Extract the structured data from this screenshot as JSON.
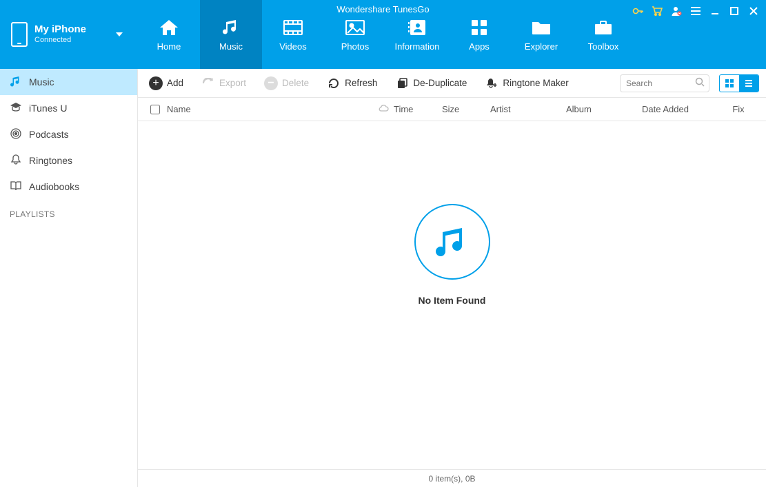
{
  "app": {
    "title": "Wondershare TunesGo"
  },
  "device": {
    "name": "My iPhone",
    "status": "Connected"
  },
  "nav": {
    "items": [
      {
        "id": "home",
        "label": "Home"
      },
      {
        "id": "music",
        "label": "Music",
        "active": true
      },
      {
        "id": "videos",
        "label": "Videos"
      },
      {
        "id": "photos",
        "label": "Photos"
      },
      {
        "id": "information",
        "label": "Information"
      },
      {
        "id": "apps",
        "label": "Apps"
      },
      {
        "id": "explorer",
        "label": "Explorer"
      },
      {
        "id": "toolbox",
        "label": "Toolbox"
      }
    ]
  },
  "sidebar": {
    "items": [
      {
        "id": "music",
        "label": "Music",
        "active": true
      },
      {
        "id": "itunesu",
        "label": "iTunes U"
      },
      {
        "id": "podcasts",
        "label": "Podcasts"
      },
      {
        "id": "ringtones",
        "label": "Ringtones"
      },
      {
        "id": "audiobooks",
        "label": "Audiobooks"
      }
    ],
    "playlists_heading": "PLAYLISTS"
  },
  "toolbar": {
    "add": "Add",
    "export": "Export",
    "delete": "Delete",
    "refresh": "Refresh",
    "dedup": "De-Duplicate",
    "ringtone": "Ringtone Maker",
    "search_placeholder": "Search"
  },
  "columns": {
    "name": "Name",
    "time": "Time",
    "size": "Size",
    "artist": "Artist",
    "album": "Album",
    "date_added": "Date Added",
    "fix": "Fix"
  },
  "empty": {
    "message": "No Item Found"
  },
  "status": {
    "text": "0 item(s), 0B"
  }
}
